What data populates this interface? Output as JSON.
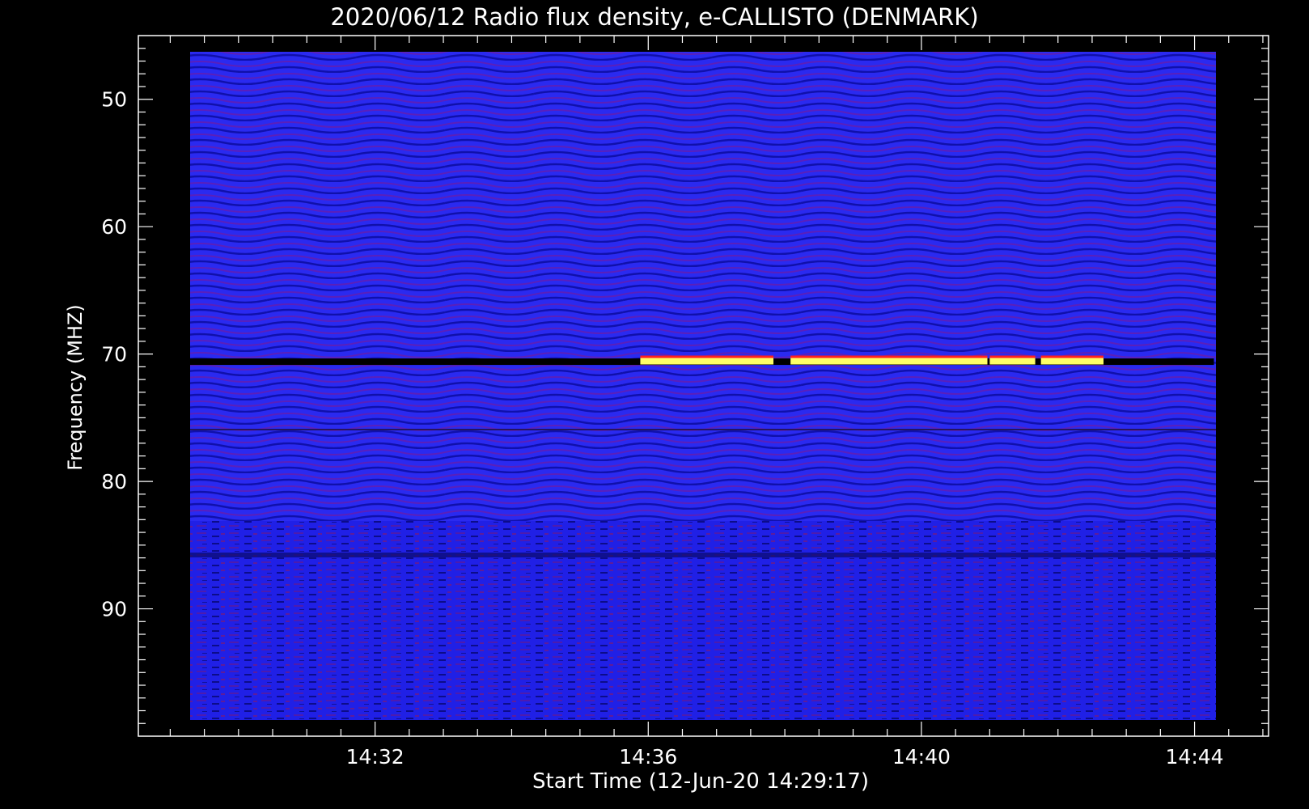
{
  "chart_data": {
    "type": "heatmap",
    "title": "2020/06/12  Radio flux density, e-CALLISTO (DENMARK)",
    "xlabel": "Start Time (12-Jun-20 14:29:17)",
    "ylabel": "Frequency (MHZ)",
    "x_ticks": [
      "14:32",
      "14:36",
      "14:40",
      "14:44"
    ],
    "y_ticks": [
      "50",
      "60",
      "70",
      "80",
      "90"
    ],
    "x_range": [
      "14:28:32",
      "14:45:05"
    ],
    "y_range": [
      45,
      100
    ],
    "y_inverted": true,
    "data_extent": {
      "x": [
        "14:29:17",
        "14:44:17"
      ],
      "y": [
        46,
        100
      ]
    },
    "colors": {
      "background_noise": "#2020ee",
      "dark_band": "#000000",
      "burst": "#ffff66",
      "burst_edge": "#ff2020",
      "frame": "#ffffff"
    },
    "features": [
      {
        "label": "narrowband interference",
        "freq_mhz": 70.6,
        "start": "14:29:17",
        "end": "14:44:17",
        "color": "#000000"
      },
      {
        "label": "bright emission",
        "freq_mhz": 70.5,
        "segments": [
          [
            "14:35:53",
            "14:37:50"
          ],
          [
            "14:38:05",
            "14:40:58"
          ],
          [
            "14:41:00",
            "14:41:40"
          ],
          [
            "14:41:45",
            "14:42:40"
          ]
        ],
        "color": "#ffff66"
      }
    ]
  }
}
